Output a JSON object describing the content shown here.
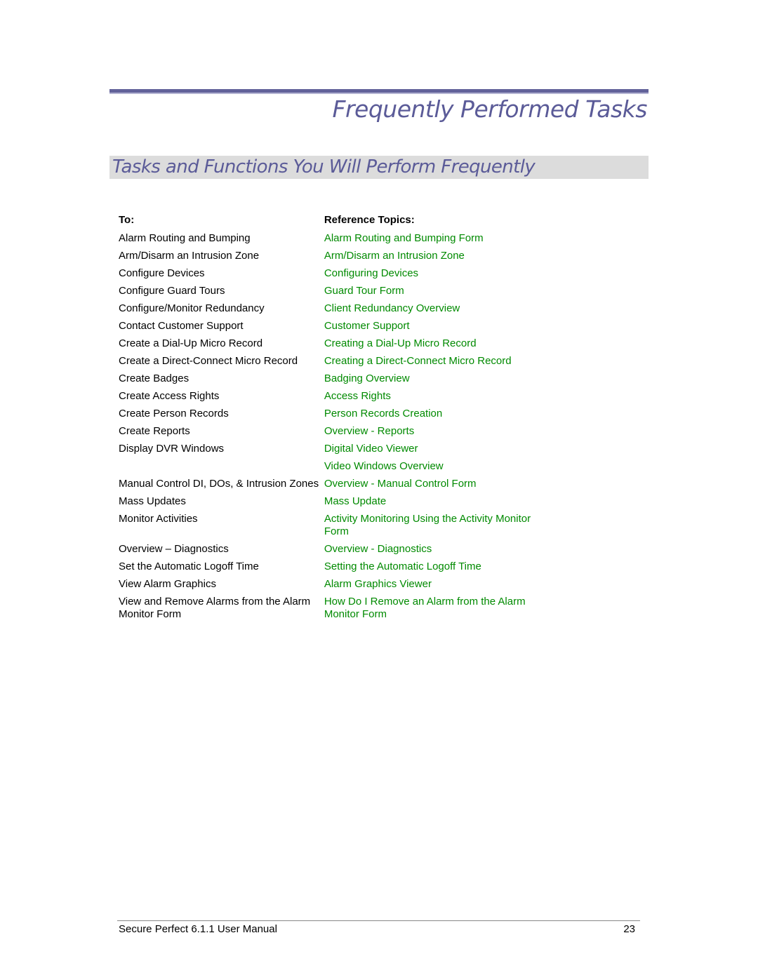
{
  "page": {
    "chapter_title": "Frequently Performed Tasks",
    "section_title": "Tasks and Functions You Will Perform Frequently",
    "colors": {
      "accent": "#5b5b98",
      "link": "#008a00",
      "section_bg": "#dcdcdc"
    }
  },
  "table": {
    "headers": {
      "to": "To:",
      "reference": "Reference Topics:"
    },
    "rows": [
      {
        "to": "Alarm Routing and Bumping",
        "refs": [
          "Alarm Routing and Bumping Form"
        ]
      },
      {
        "to": "Arm/Disarm an Intrusion Zone",
        "refs": [
          "Arm/Disarm an Intrusion Zone"
        ]
      },
      {
        "to": "Configure Devices",
        "refs": [
          "Configuring Devices"
        ]
      },
      {
        "to": "Configure Guard Tours",
        "refs": [
          "Guard Tour Form"
        ]
      },
      {
        "to": "Configure/Monitor Redundancy",
        "refs": [
          "Client Redundancy Overview"
        ]
      },
      {
        "to": "Contact Customer Support",
        "refs": [
          "Customer Support"
        ]
      },
      {
        "to": "Create a Dial-Up Micro Record",
        "refs": [
          "Creating a Dial-Up Micro Record"
        ]
      },
      {
        "to": "Create a Direct-Connect Micro Record",
        "refs": [
          "Creating a Direct-Connect Micro Record"
        ]
      },
      {
        "to": "Create Badges",
        "refs": [
          "Badging Overview"
        ]
      },
      {
        "to": "Create Access Rights",
        "refs": [
          "Access Rights"
        ]
      },
      {
        "to": "Create Person Records",
        "refs": [
          "Person Records Creation"
        ]
      },
      {
        "to": "Create Reports",
        "refs": [
          "Overview - Reports"
        ]
      },
      {
        "to": "Display DVR Windows",
        "refs": [
          "Digital Video Viewer",
          "Video Windows Overview"
        ]
      },
      {
        "to": "Manual Control DI, DOs, & Intrusion Zones",
        "refs": [
          "Overview - Manual Control Form"
        ]
      },
      {
        "to": "Mass Updates",
        "refs": [
          "Mass Update"
        ]
      },
      {
        "to": "Monitor Activities",
        "refs": [
          "Activity Monitoring Using the Activity Monitor Form"
        ]
      },
      {
        "to": "Overview – Diagnostics",
        "refs": [
          "Overview - Diagnostics"
        ]
      },
      {
        "to": "Set the Automatic Logoff Time",
        "refs": [
          "Setting the Automatic Logoff Time"
        ]
      },
      {
        "to": "View Alarm Graphics",
        "refs": [
          "Alarm Graphics Viewer"
        ]
      },
      {
        "to": "View and Remove Alarms from the Alarm Monitor Form",
        "refs": [
          "How Do I Remove an Alarm from the Alarm Monitor Form"
        ]
      }
    ]
  },
  "footer": {
    "manual_title": "Secure Perfect 6.1.1 User Manual",
    "page_number": "23"
  }
}
